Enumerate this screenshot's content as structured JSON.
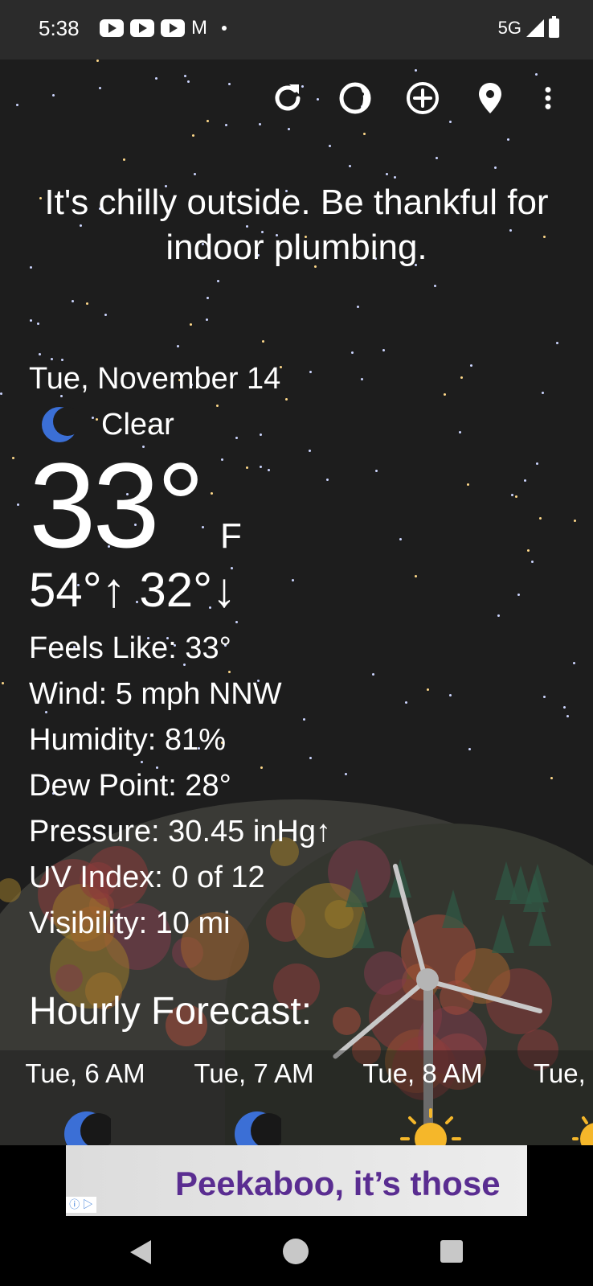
{
  "status_bar": {
    "time": "5:38",
    "network": "5G",
    "notification_icons": [
      "youtube-icon",
      "youtube-icon",
      "youtube-icon",
      "gmail-icon",
      "dot-icon"
    ]
  },
  "toolbar": {
    "icons": [
      "refresh-icon",
      "theme-icon",
      "add-icon",
      "location-pin-icon",
      "overflow-menu-icon"
    ]
  },
  "tagline": "It's chilly outside. Be thankful for indoor plumbing.",
  "current": {
    "date": "Tue, November 14",
    "condition": "Clear",
    "condition_icon": "moon-icon",
    "temperature": "33°",
    "unit": "F",
    "hi_lo": "54°↑ 32°↓",
    "details": [
      "Feels Like:  33°",
      "Wind:  5 mph NNW",
      "Humidity:  81%",
      "Dew Point:  28°",
      "Pressure:  30.45 inHg↑",
      "UV Index:  0 of 12",
      "Visibility:  10 mi"
    ]
  },
  "hourly": {
    "title": "Hourly Forecast:",
    "items": [
      {
        "time": "Tue, 6 AM",
        "icon": "moon-icon"
      },
      {
        "time": "Tue, 7 AM",
        "icon": "moon-icon"
      },
      {
        "time": "Tue, 8 AM",
        "icon": "sun-icon"
      },
      {
        "time": "Tue,",
        "icon": "sun-icon"
      }
    ]
  },
  "ad": {
    "text": "Peekaboo, it’s those",
    "choices_label": "ⓘ ▷"
  },
  "colors": {
    "moon": "#3b6fd6",
    "sun": "#f5b72a",
    "ad_text": "#5a2d91"
  }
}
